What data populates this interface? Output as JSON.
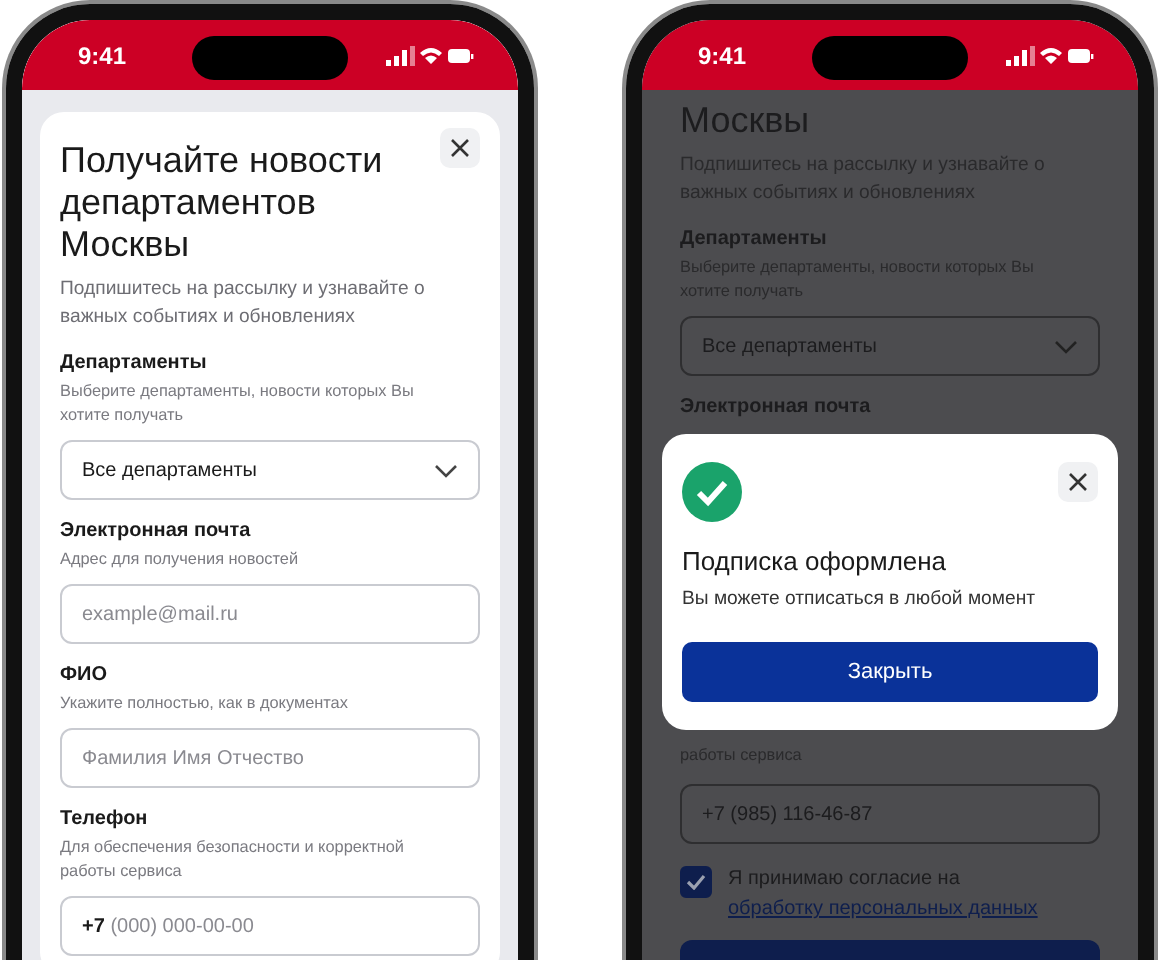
{
  "left_phone": {
    "status_time": "9:41",
    "title": "Получайте новости департаментов Москвы",
    "subtitle": "Подпишитесь на рассылку и узнавайте о важных событиях и обновлениях",
    "fields": [
      {
        "kind": "select",
        "label": "Департаменты",
        "hint": "Выберите департаменты, новости которых Вы хотите получать",
        "value": "Все департаменты"
      },
      {
        "kind": "input",
        "label": "Электронная почта",
        "hint": "Адрес для получения новостей",
        "placeholder": "example@mail.ru"
      },
      {
        "kind": "input",
        "label": "ФИО",
        "hint": "Укажите полностью, как в документах",
        "placeholder": "Фамилия Имя Отчество"
      },
      {
        "kind": "phone",
        "label": "Телефон",
        "hint": "Для обеспечения безопасности и корректной работы сервиса",
        "prefix": "+7",
        "placeholder": "(000) 000-00-00"
      }
    ]
  },
  "right_phone": {
    "status_time": "9:41",
    "title": "Москвы",
    "subtitle": "Подпишитесь на рассылку и узнавайте о важных событиях и обновлениях",
    "department": {
      "label": "Департаменты",
      "hint": "Выберите департаменты, новости которых Вы хотите получать",
      "value": "Все департаменты"
    },
    "email_label": "Электронная почта",
    "phone_hint": "работы сервиса",
    "phone_value": "+7 (985) 116-46-87",
    "consent": {
      "checked": true,
      "text": "Я принимаю согласие на",
      "link": "обработку персональных данных"
    },
    "modal": {
      "title": "Подписка оформлена",
      "text": "Вы можете отписаться в любой момент",
      "button": "Закрыть"
    }
  }
}
